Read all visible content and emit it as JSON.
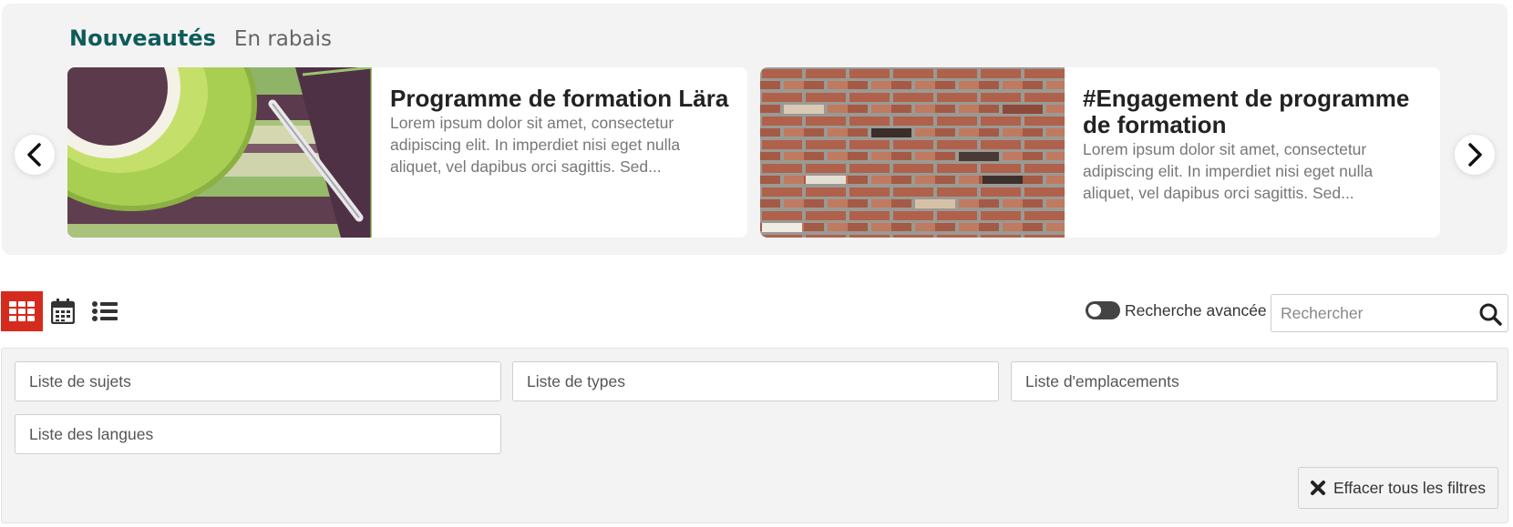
{
  "featured": {
    "tabs": [
      {
        "label": "Nouveautés",
        "active": true
      },
      {
        "label": "En rabais",
        "active": false
      }
    ],
    "cards": [
      {
        "title": "Programme de formation Lära",
        "description": "Lorem ipsum dolor sit amet, consectetur adipiscing elit. In imperdiet nisi eget nulla aliquet, vel dapibus orci sagittis. Sed...",
        "image": "coffee-cup-and-pen-photo"
      },
      {
        "title": "#Engagement de programme de formation",
        "description": "Lorem ipsum dolor sit amet, consectetur adipiscing elit. In imperdiet nisi eget nulla aliquet, vel dapibus orci sagittis. Sed...",
        "image": "brick-wall-photo"
      }
    ],
    "prev_icon": "chevron-left-icon",
    "next_icon": "chevron-right-icon"
  },
  "toolbar": {
    "views": [
      {
        "icon": "grid-icon",
        "active": true
      },
      {
        "icon": "calendar-icon",
        "active": false
      },
      {
        "icon": "list-icon",
        "active": false
      }
    ],
    "advanced_search_label": "Recherche avancée",
    "advanced_search_on": false,
    "search_placeholder": "Rechercher",
    "search_icon": "search-icon"
  },
  "filters": {
    "subjects_placeholder": "Liste de sujets",
    "types_placeholder": "Liste de types",
    "locations_placeholder": "Liste d'emplacements",
    "languages_placeholder": "Liste des langues",
    "clear_label": "Effacer tous les filtres",
    "clear_icon": "close-icon"
  },
  "colors": {
    "brand_teal": "#0d5c5a",
    "accent_red": "#d52b1e",
    "panel_bg": "#f3f3f3"
  }
}
